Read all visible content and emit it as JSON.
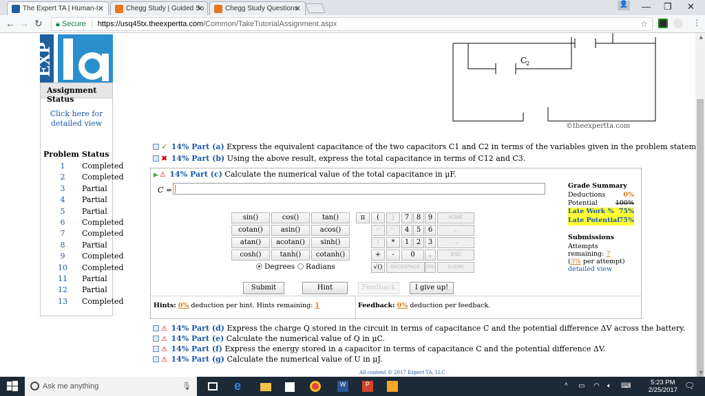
{
  "browser": {
    "tabs": [
      {
        "title": "The Expert TA | Human-I",
        "favicon_color": "#1f5f9e"
      },
      {
        "title": "Chegg Study | Guided So",
        "favicon_color": "#e87722"
      },
      {
        "title": "Chegg Study Questions",
        "favicon_color": "#e87722"
      }
    ],
    "window_controls": {
      "minimize": "—",
      "maximize": "❐",
      "close": "✕"
    },
    "address": {
      "secure_label": "Secure",
      "host": "https://usq45tx.theexpertta.com",
      "path": "/Common/TakeTutorialAssignment.aspx"
    }
  },
  "sidebar": {
    "logo_text": "EXP",
    "assignment_status": "Assignment Status",
    "click_link": "Click here for detailed view",
    "headers": {
      "problem": "Problem",
      "status": "Status"
    },
    "problems": [
      {
        "num": "1",
        "status": "Completed"
      },
      {
        "num": "2",
        "status": "Completed"
      },
      {
        "num": "3",
        "status": "Partial"
      },
      {
        "num": "4",
        "status": "Partial"
      },
      {
        "num": "5",
        "status": "Partial"
      },
      {
        "num": "6",
        "status": "Completed"
      },
      {
        "num": "7",
        "status": "Completed"
      },
      {
        "num": "8",
        "status": "Partial"
      },
      {
        "num": "9",
        "status": "Completed"
      },
      {
        "num": "10",
        "status": "Completed"
      },
      {
        "num": "11",
        "status": "Partial"
      },
      {
        "num": "12",
        "status": "Partial"
      },
      {
        "num": "13",
        "status": "Completed"
      }
    ]
  },
  "circuit": {
    "label_c2": "C",
    "label_c2_sub": "2",
    "copyright": "©theexpertta.com"
  },
  "parts": {
    "a": {
      "pct": "14% Part (a)",
      "text": "Express the equivalent capacitance of the two capacitors C1 and C2 in terms of the variables given in the problem statement."
    },
    "b": {
      "pct": "14% Part (b)",
      "text": "Using the above result, express the total capacitance in terms of C12 and C3."
    },
    "c": {
      "pct": "14% Part (c)",
      "text": "Calculate the numerical value of the total capacitance in μF."
    },
    "d": {
      "pct": "14% Part (d)",
      "text": "Express the charge Q stored in the circuit in terms of capacitance C and the potential difference ΔV across the battery."
    },
    "e": {
      "pct": "14% Part (e)",
      "text": "Calculate the numerical value of Q in μC."
    },
    "f": {
      "pct": "14% Part (f)",
      "text": "Express the energy stored in a capacitor in terms of capacitance C and the potential difference ΔV."
    },
    "g": {
      "pct": "14% Part (g)",
      "text": "Calculate the numerical value of U in μJ."
    }
  },
  "answer": {
    "label": "C =",
    "value": ""
  },
  "grade_summary": {
    "title": "Grade Summary",
    "deductions_label": "Deductions",
    "deductions_value": "0%",
    "potential_label": "Potential",
    "potential_value": "100%",
    "late_work_label": "Late Work %",
    "late_work_value": "75%",
    "late_potential_label": "Late Potential",
    "late_potential_value": "75%",
    "submissions_title": "Submissions",
    "attempts_label": "Attempts remaining:",
    "attempts_value": "7",
    "per_attempt_pct": "3%",
    "per_attempt_text": "per attempt)",
    "detailed_view": "detailed view"
  },
  "keypad": {
    "functions": [
      [
        "sin()",
        "cos()",
        "tan()"
      ],
      [
        "cotan()",
        "asin()",
        "acos()"
      ],
      [
        "atan()",
        "acotan()",
        "sinh()"
      ],
      [
        "cosh()",
        "tanh()",
        "cotanh()"
      ]
    ],
    "symbols": [
      "π",
      "(",
      ")",
      "7",
      "8",
      "9",
      "HOME",
      "↑^",
      "^↓",
      "4",
      "5",
      "6",
      "←",
      "/",
      "*",
      "1",
      "2",
      "3",
      "→",
      "+",
      "-",
      "0",
      ".",
      "END",
      "√()",
      "BACKSPACE",
      "DEL",
      "CLEAR"
    ],
    "degrees": "Degrees",
    "radians": "Radians"
  },
  "actions": {
    "submit": "Submit",
    "hint": "Hint",
    "feedback": "Feedback",
    "give_up": "I give up!"
  },
  "hints": {
    "label": "Hints:",
    "pct": "0%",
    "text": "deduction per hint. Hints remaining:",
    "remaining": "1"
  },
  "feedback": {
    "label": "Feedback:",
    "pct": "0%",
    "text": "deduction per feedback."
  },
  "footer": "All content © 2017 Expert TA, LLC",
  "taskbar": {
    "search": "Ask me anything",
    "time": "5:23 PM",
    "date": "2/25/2017"
  }
}
